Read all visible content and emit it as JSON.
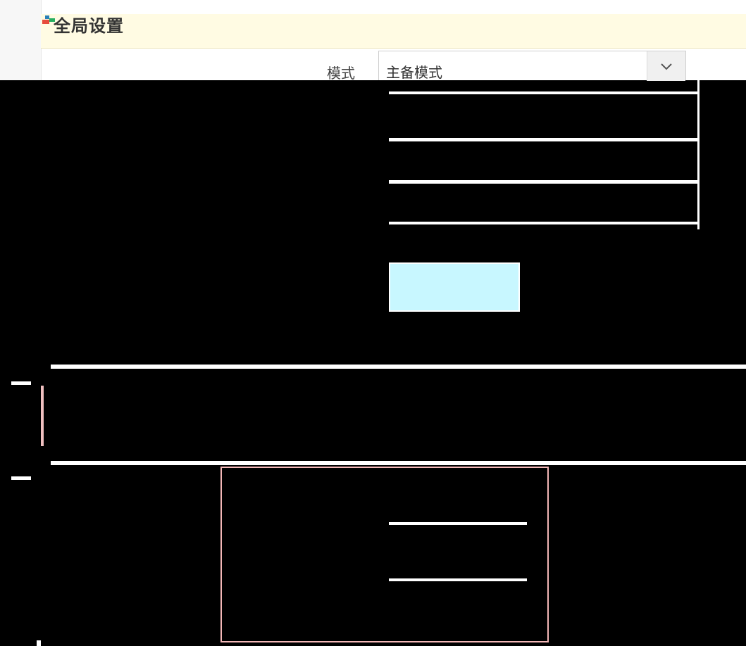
{
  "header": {
    "title": "全局设置"
  },
  "form": {
    "mode_label": "模式",
    "mode_value": "主备模式"
  },
  "colors": {
    "title_bar": "#fffbe3",
    "body_background": "#000000",
    "apply_button": "#c8f7ff",
    "highlight_border": "#f3b7b7"
  }
}
